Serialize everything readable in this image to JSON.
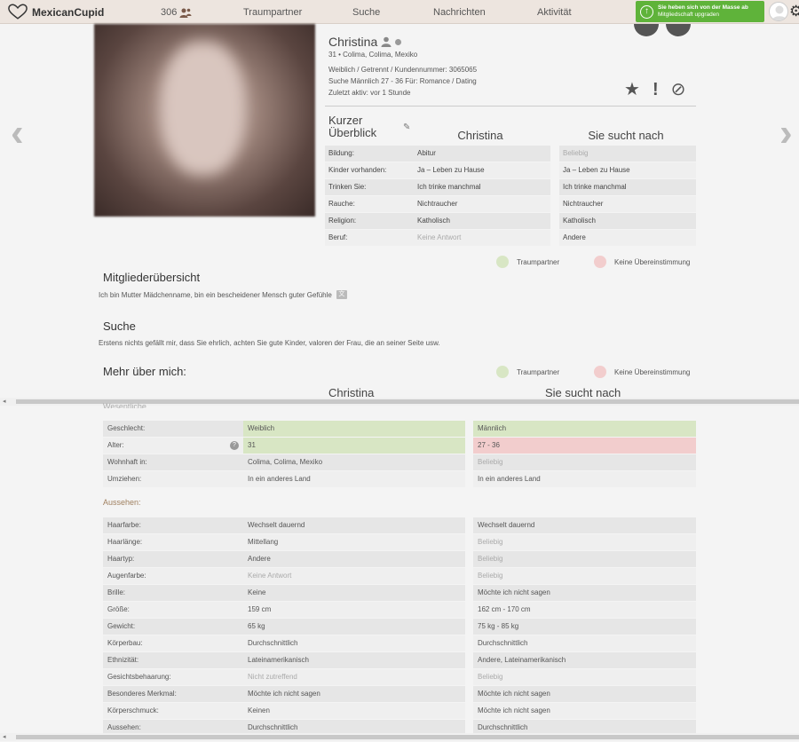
{
  "nav": {
    "brand": "MexicanCupid",
    "count": "306",
    "links": [
      "Traumpartner",
      "Suche",
      "Nachrichten",
      "Aktivität"
    ],
    "upgrade_line1": "Sie heben sich von der Masse ab",
    "upgrade_line2": "Mitgliedschaft upgraden"
  },
  "profile": {
    "name": "Christina",
    "location": "31 • Colima, Colima, Mexiko",
    "line1": "Weiblich / Getrennt / Kundennummer: 3065065",
    "line2": "Suche Männlich 27 - 36 Für: Romance / Dating",
    "line3": "Zuletzt aktiv: vor 1 Stunde"
  },
  "overview": {
    "title": "Kurzer Überblick",
    "col_her": "Christina",
    "col_seeks": "Sie sucht nach",
    "rows": [
      {
        "label": "Bildung:",
        "her": "Abitur",
        "seeks": "Beliebig",
        "seeks_muted": true
      },
      {
        "label": "Kinder vorhanden:",
        "her": "Ja – Leben zu Hause",
        "seeks": "Ja – Leben zu Hause"
      },
      {
        "label": "Trinken Sie:",
        "her": "Ich trinke manchmal",
        "seeks": "Ich trinke manchmal"
      },
      {
        "label": "Rauche:",
        "her": "Nichtraucher",
        "seeks": "Nichtraucher"
      },
      {
        "label": "Religion:",
        "her": "Katholisch",
        "seeks": "Katholisch"
      },
      {
        "label": "Beruf:",
        "her": "Keine Antwort",
        "her_muted": true,
        "seeks": "Andere"
      }
    ]
  },
  "legend": {
    "match": "Traumpartner",
    "nomatch": "Keine Übereinstimmung"
  },
  "member": {
    "title": "Mitgliederübersicht",
    "text": "Ich bin Mutter Mädchenname, bin ein bescheidener Mensch guter Gefühle"
  },
  "search": {
    "title": "Suche",
    "text": "Erstens nichts gefällt mir, dass Sie ehrlich, achten Sie gute Kinder, valoren der Frau, die an seiner Seite usw."
  },
  "more": {
    "title": "Mehr über mich:",
    "col_her": "Christina",
    "col_seeks": "Sie sucht nach",
    "section_basic": "Wesentliche",
    "basic": [
      {
        "label": "Geschlecht:",
        "her": "Weiblich",
        "seeks": "Männlich",
        "her_hl": "green",
        "seeks_hl": "green"
      },
      {
        "label": "Alter:",
        "her": "31",
        "seeks": "27 - 36",
        "her_hl": "green",
        "seeks_hl": "red",
        "help": true
      },
      {
        "label": "Wohnhaft in:",
        "her": "Colima, Colima, Mexiko",
        "seeks": "Beliebig",
        "seeks_muted": true
      },
      {
        "label": "Umziehen:",
        "her": "In ein anderes Land",
        "seeks": "In ein anderes Land"
      }
    ],
    "section_looks": "Aussehen:",
    "looks": [
      {
        "label": "Haarfarbe:",
        "her": "Wechselt dauernd",
        "seeks": "Wechselt dauernd"
      },
      {
        "label": "Haarlänge:",
        "her": "Mittellang",
        "seeks": "Beliebig",
        "seeks_muted": true
      },
      {
        "label": "Haartyp:",
        "her": "Andere",
        "seeks": "Beliebig",
        "seeks_muted": true
      },
      {
        "label": "Augenfarbe:",
        "her": "Keine Antwort",
        "her_muted": true,
        "seeks": "Beliebig",
        "seeks_muted": true
      },
      {
        "label": "Brille:",
        "her": "Keine",
        "seeks": "Möchte ich nicht sagen"
      },
      {
        "label": "Größe:",
        "her": "159 cm",
        "seeks": "162 cm - 170 cm"
      },
      {
        "label": "Gewicht:",
        "her": "65 kg",
        "seeks": "75 kg - 85 kg"
      },
      {
        "label": "Körperbau:",
        "her": "Durchschnittlich",
        "seeks": "Durchschnittlich"
      },
      {
        "label": "Ethnizität:",
        "her": "Lateinamerikanisch",
        "seeks": "Andere, Lateinamerikanisch"
      },
      {
        "label": "Gesichtsbehaarung:",
        "her": "Nicht zutreffend",
        "her_muted": true,
        "seeks": "Beliebig",
        "seeks_muted": true
      },
      {
        "label": "Besonderes Merkmal:",
        "her": "Möchte ich nicht sagen",
        "seeks": "Möchte ich nicht sagen"
      },
      {
        "label": "Körperschmuck:",
        "her": "Keinen",
        "seeks": "Möchte ich nicht sagen"
      },
      {
        "label": "Aussehen:",
        "her": "Durchschnittlich",
        "seeks": "Durchschnittlich"
      }
    ]
  },
  "colors": {
    "match": "#d8e6c4",
    "nomatch": "#f2cdcd",
    "upgrade": "#5fb33a"
  }
}
